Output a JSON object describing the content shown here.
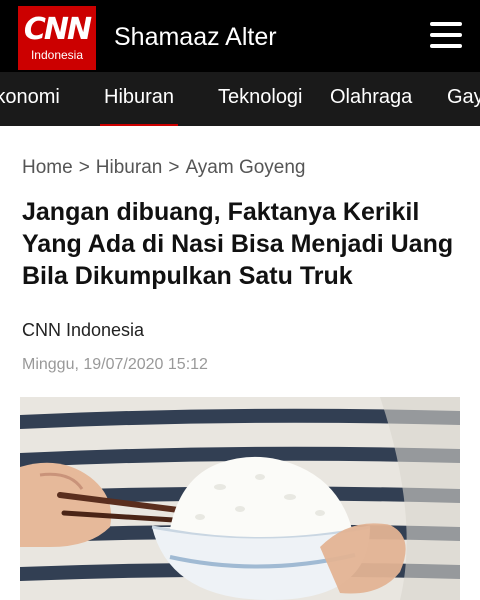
{
  "header": {
    "logo_text": "CNN",
    "logo_sub": "Indonesia",
    "site_user": "Shamaaz Alter",
    "menu_icon": "hamburger-menu-icon"
  },
  "categories": [
    {
      "label": "Ekonomi"
    },
    {
      "label": "Hiburan",
      "active": true
    },
    {
      "label": "Teknologi"
    },
    {
      "label": "Olahraga"
    },
    {
      "label": "Gaya Hidup"
    }
  ],
  "breadcrumb": {
    "home": "Home",
    "section": "Hiburan",
    "tag": "Ayam Goyeng",
    "separator": ">"
  },
  "article": {
    "title": "Jangan dibuang, Faktanya Kerikil Yang Ada di Nasi Bisa Menjadi Uang Bila Dikumpulkan Satu Truk",
    "author": "CNN Indonesia",
    "date": "Minggu, 19/07/2020 15:12"
  },
  "colors": {
    "brand_red": "#cc0000",
    "header_bg": "#000000",
    "category_bg": "#1a1a1a"
  }
}
